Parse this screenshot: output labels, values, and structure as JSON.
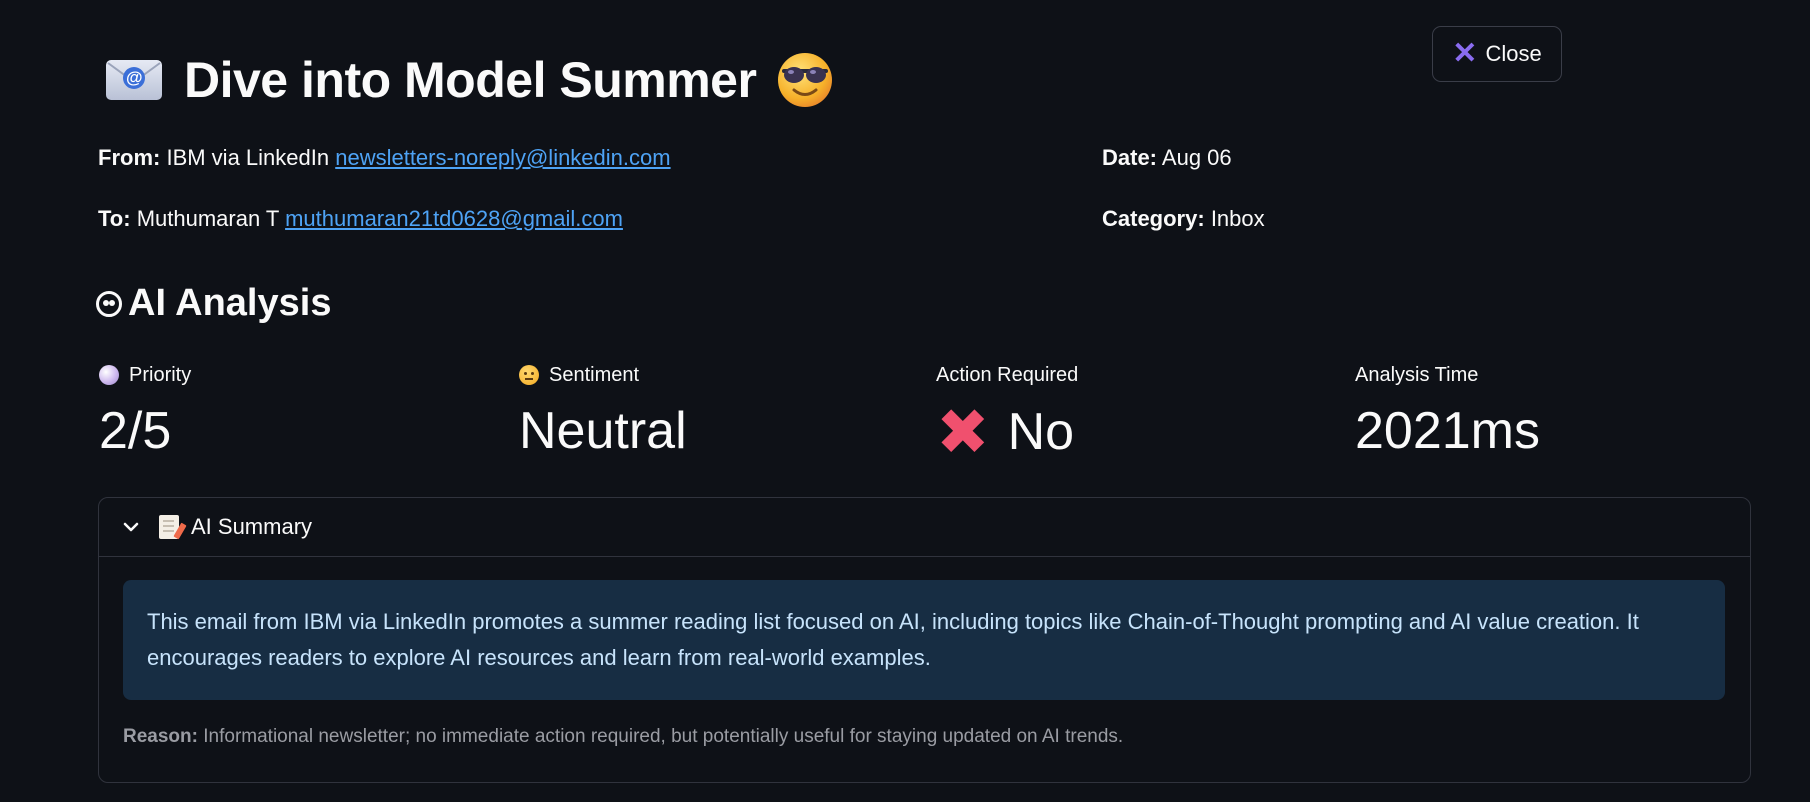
{
  "email": {
    "subject": "Dive into Model Summer",
    "from_label": "From:",
    "from_name": "IBM via LinkedIn",
    "from_email": "newsletters-noreply@linkedin.com",
    "to_label": "To:",
    "to_name": "Muthumaran T",
    "to_email": "muthumaran21td0628@gmail.com",
    "date_label": "Date:",
    "date": "Aug 06",
    "category_label": "Category:",
    "category": "Inbox"
  },
  "toolbar": {
    "close_label": "Close"
  },
  "analysis": {
    "title": "AI Analysis",
    "metrics": [
      {
        "label": "Priority",
        "value": "2/5"
      },
      {
        "label": "Sentiment",
        "value": "Neutral"
      },
      {
        "label": "Action Required",
        "value": "No"
      },
      {
        "label": "Analysis Time",
        "value": "2021ms"
      }
    ]
  },
  "summary": {
    "header": "AI Summary",
    "text": "This email from IBM via LinkedIn promotes a summer reading list focused on AI, including topics like Chain-of-Thought prompting and AI value creation. It encourages readers to explore AI resources and learn from real-world examples.",
    "reason_label": "Reason:",
    "reason": "Informational newsletter; no immediate action required, but potentially useful for staying updated on AI trends."
  },
  "colors": {
    "background": "#0e1117",
    "link": "#4ea3f5",
    "info_box": "#172d43",
    "close_icon": "#8a6cf0",
    "cross_icon": "#f0506e"
  }
}
